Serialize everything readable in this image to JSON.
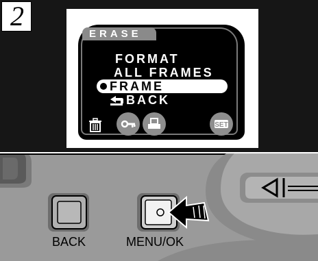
{
  "step": {
    "number": "2"
  },
  "lcd": {
    "title": "ERASE",
    "menu": {
      "format_line1": "FORMAT",
      "format_line2": "ALL FRAMES",
      "selected": "FRAME",
      "back": "BACK"
    },
    "icons": [
      "trash-icon",
      "protect-key-icon",
      "print-icon",
      "set-icon"
    ],
    "set_label": "SET"
  },
  "camera": {
    "back_button_label": "BACK",
    "menu_ok_button_label": "MENU/OK"
  },
  "colors": {
    "top_panel_bg": "#161616",
    "lcd_frame": "#ffffff",
    "screen_bg": "#000000",
    "camera_body": "#9a9a9a",
    "icon_grey": "#8e8e8e"
  }
}
